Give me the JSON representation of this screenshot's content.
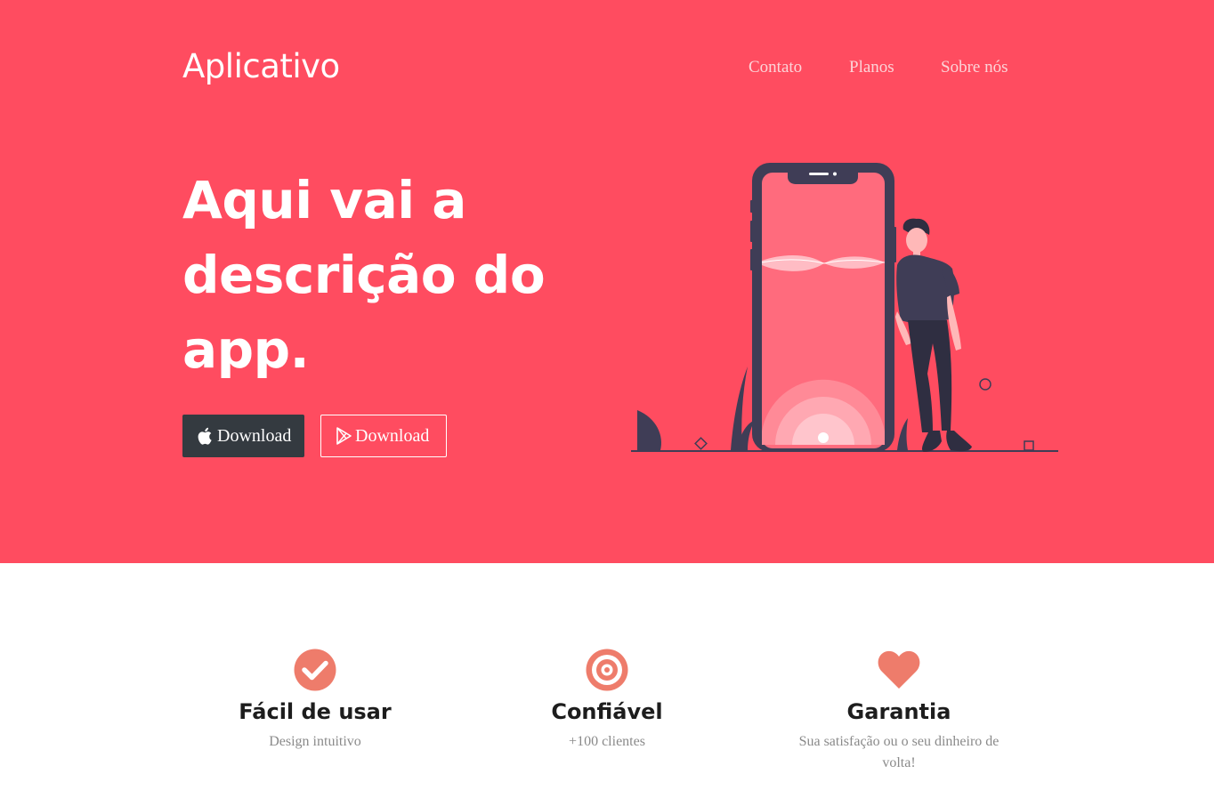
{
  "header": {
    "brand": "Aplicativo",
    "nav": [
      "Contato",
      "Planos",
      "Sobre nós"
    ]
  },
  "hero": {
    "headline": "Aqui vai a descrição do app.",
    "buttons": [
      {
        "label": "Download",
        "icon": "apple-icon"
      },
      {
        "label": "Download",
        "icon": "google-play-icon"
      }
    ],
    "illustration": "person-leaning-on-phone-illustration"
  },
  "features": [
    {
      "icon": "check-circle-icon",
      "title": "Fácil de usar",
      "description": "Design intuitivo"
    },
    {
      "icon": "target-icon",
      "title": "Confiável",
      "description": "+100 clientes"
    },
    {
      "icon": "heart-icon",
      "title": "Garantia",
      "description": "Sua satisfação ou o seu dinheiro de volta!"
    }
  ],
  "colors": {
    "primary": "#ff4c60",
    "dark": "#343a40",
    "accent": "#ee7c6b",
    "illustration_dark": "#3f3d56"
  }
}
